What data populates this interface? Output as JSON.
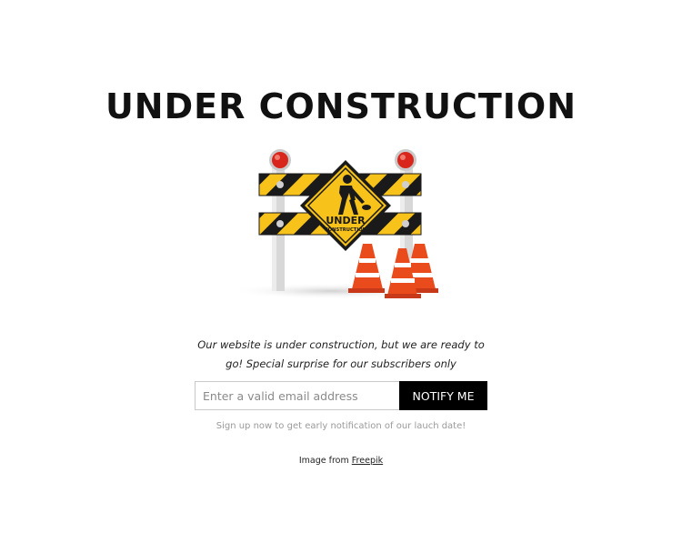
{
  "header": {
    "title": "UNDER CONSTRUCTION"
  },
  "illustration": {
    "sign_text_line1": "UNDER",
    "sign_text_line2": "CONSTRUCTION",
    "colors": {
      "stripe_yellow": "#f7c21a",
      "stripe_black": "#1a1a1a",
      "cone_orange": "#ea4b1c",
      "lamp_red": "#d9261c",
      "post_gray": "#d8d8d8"
    }
  },
  "message": {
    "line1": "Our website is under construction, but we are ready to",
    "line2": "go! Special surprise for our subscribers only"
  },
  "form": {
    "email_placeholder": "Enter a valid email address",
    "notify_label": "NOTIFY ME"
  },
  "signup_note": "Sign up now to get early notification of our lauch date!",
  "credit": {
    "prefix": "Image from",
    "link_text": "Freepik"
  }
}
